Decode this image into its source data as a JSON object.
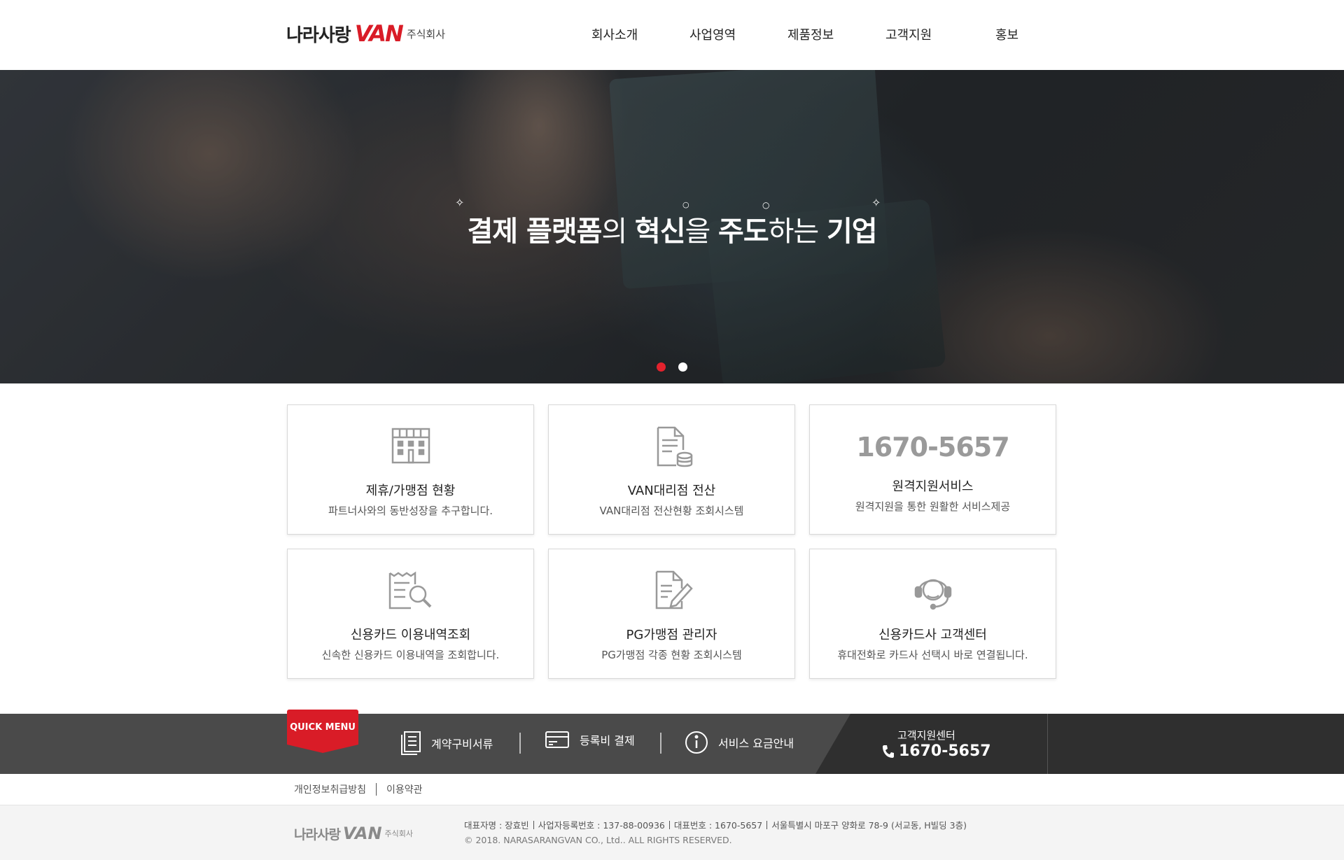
{
  "header": {
    "logo": {
      "korean": "나라사랑",
      "van": "VAN",
      "corp": "주식회사"
    },
    "nav": [
      {
        "label": "회사소개"
      },
      {
        "label": "사업영역"
      },
      {
        "label": "제품정보"
      },
      {
        "label": "고객지원"
      },
      {
        "label": "홍보"
      }
    ]
  },
  "hero": {
    "title": {
      "part1": "결제 플랫폼",
      "part2": "의 ",
      "part3": "혁신",
      "part4": "을 ",
      "part5": "주도",
      "part6": "하는 ",
      "part7": "기업"
    },
    "slides": {
      "total": 2,
      "active": 1
    }
  },
  "cards": [
    {
      "title": "제휴/가맹점 현황",
      "desc": "파트너사와의 동반성장을 추구합니다.",
      "icon": "store-icon"
    },
    {
      "title": "VAN대리점 전산",
      "desc": "VAN대리점 전산현황 조회시스템",
      "icon": "document-coins-icon"
    },
    {
      "phone": "1670-5657",
      "title": "원격지원서비스",
      "desc": "원격지원을 통한 원활한 서비스제공"
    },
    {
      "title": "신용카드 이용내역조회",
      "desc": "신속한 신용카드 이용내역을 조회합니다.",
      "icon": "receipt-search-icon"
    },
    {
      "title": "PG가맹점 관리자",
      "desc": "PG가맹점 각종 현황 조회시스템",
      "icon": "document-edit-icon"
    },
    {
      "title": "신용카드사 고객센터",
      "desc": "휴대전화로 카드사 선택시 바로 연결됩니다.",
      "icon": "headset-agent-icon"
    }
  ],
  "quick_menu": {
    "tag": "QUICK MENU",
    "items": [
      {
        "label": "계약구비서류",
        "icon": "document-list-icon"
      },
      {
        "label": "등록비 결제",
        "icon": "card-icon"
      },
      {
        "label": "서비스 요금안내",
        "icon": "info-icon"
      }
    ],
    "support": {
      "label": "고객지원센터",
      "phone": "1670-5657"
    }
  },
  "footer": {
    "links": [
      "개인정보취급방침",
      "이용약관"
    ],
    "logo": {
      "korean": "나라사랑",
      "van": "VAN",
      "corp": "주식회사"
    },
    "info": [
      "대표자명 : 장효빈",
      "사업자등록번호 : 137-88-00936",
      "대표번호 : 1670-5657",
      "서울특별시 마포구 양화로 78-9 (서교동, H빌딩 3층)"
    ],
    "copyright": "© 2018. NARASARANGVAN CO., Ltd.. ALL RIGHTS RESERVED."
  },
  "colors": {
    "accent": "#d91c27",
    "bar": "#4a4a4a",
    "bar_dark": "#2f2f2f"
  }
}
